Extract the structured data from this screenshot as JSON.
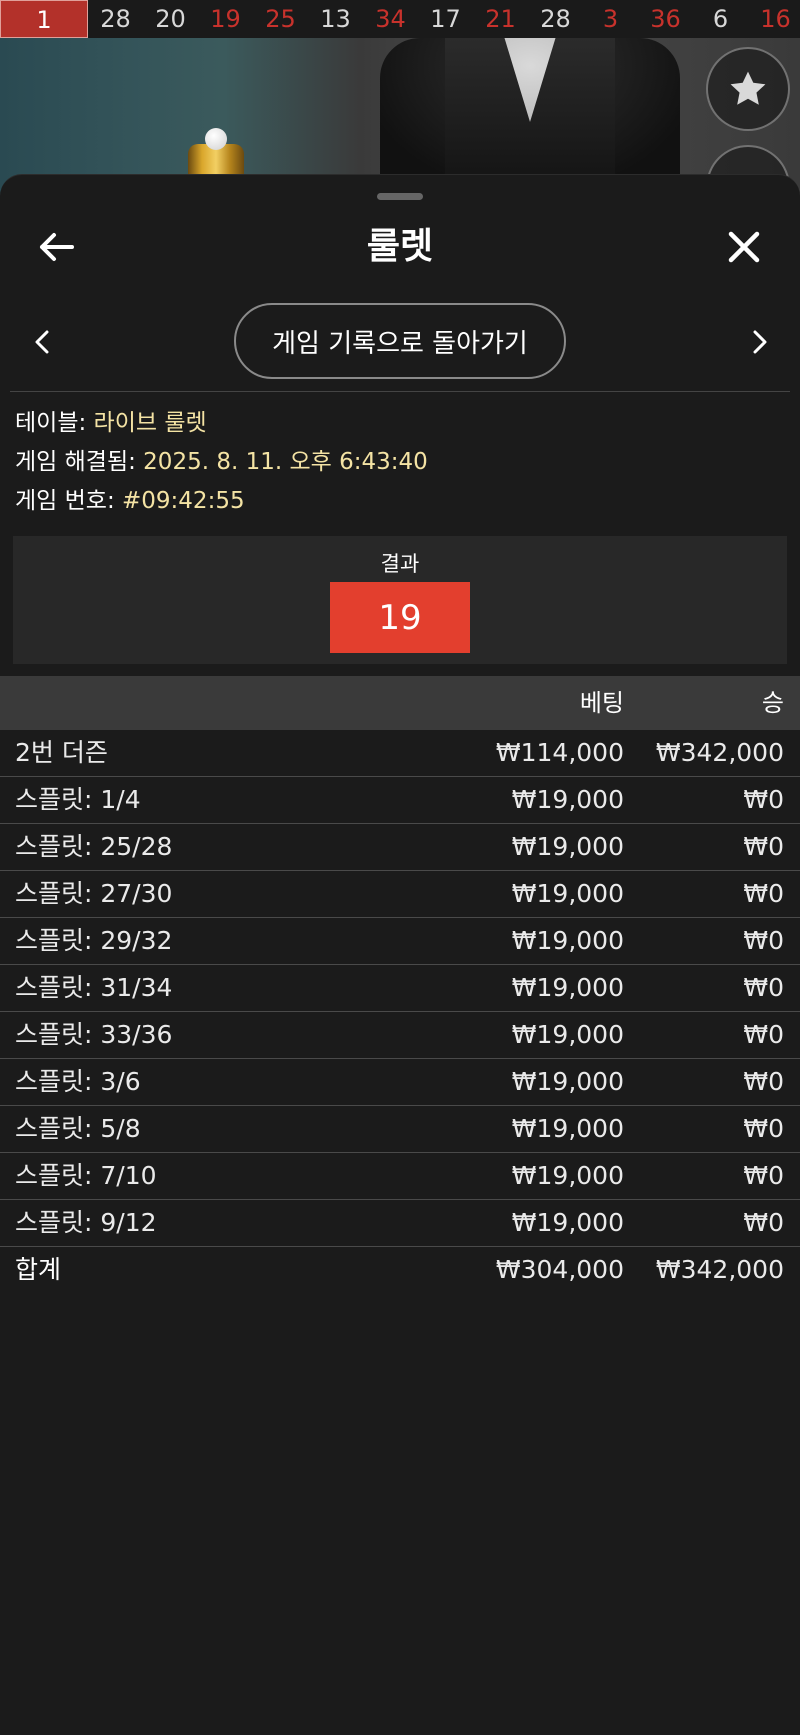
{
  "history": {
    "numbers": [
      {
        "value": "1",
        "color": "red",
        "highlight": true
      },
      {
        "value": "28",
        "color": "black"
      },
      {
        "value": "20",
        "color": "black"
      },
      {
        "value": "19",
        "color": "red"
      },
      {
        "value": "25",
        "color": "red"
      },
      {
        "value": "13",
        "color": "black"
      },
      {
        "value": "34",
        "color": "red"
      },
      {
        "value": "17",
        "color": "black"
      },
      {
        "value": "21",
        "color": "red"
      },
      {
        "value": "28",
        "color": "black"
      },
      {
        "value": "3",
        "color": "red"
      },
      {
        "value": "36",
        "color": "red"
      },
      {
        "value": "6",
        "color": "black"
      },
      {
        "value": "16",
        "color": "red"
      }
    ]
  },
  "header": {
    "title": "룰렛",
    "back_icon": "arrow-left-icon",
    "close_icon": "close-icon"
  },
  "nav": {
    "back_to_history_label": "게임 기록으로 돌아가기",
    "prev_icon": "chevron-left-icon",
    "next_icon": "chevron-right-icon"
  },
  "meta": {
    "table_label": "테이블: ",
    "table_value": "라이브 룰렛",
    "resolved_label": "게임 해결됨: ",
    "resolved_value": "2025. 8. 11. 오후 6:43:40",
    "game_no_label": "게임 번호: ",
    "game_no_value": "#09:42:55"
  },
  "result": {
    "label": "결과",
    "number": "19",
    "color": "#e33f2e"
  },
  "bets_table": {
    "col_bet": "베팅",
    "col_win": "승",
    "rows": [
      {
        "name": "2번 더즌",
        "bet": "₩114,000",
        "win": "₩342,000"
      },
      {
        "name": "스플릿: 1/4",
        "bet": "₩19,000",
        "win": "₩0"
      },
      {
        "name": "스플릿: 25/28",
        "bet": "₩19,000",
        "win": "₩0"
      },
      {
        "name": "스플릿: 27/30",
        "bet": "₩19,000",
        "win": "₩0"
      },
      {
        "name": "스플릿: 29/32",
        "bet": "₩19,000",
        "win": "₩0"
      },
      {
        "name": "스플릿: 31/34",
        "bet": "₩19,000",
        "win": "₩0"
      },
      {
        "name": "스플릿: 33/36",
        "bet": "₩19,000",
        "win": "₩0"
      },
      {
        "name": "스플릿: 3/6",
        "bet": "₩19,000",
        "win": "₩0"
      },
      {
        "name": "스플릿: 5/8",
        "bet": "₩19,000",
        "win": "₩0"
      },
      {
        "name": "스플릿: 7/10",
        "bet": "₩19,000",
        "win": "₩0"
      },
      {
        "name": "스플릿: 9/12",
        "bet": "₩19,000",
        "win": "₩0"
      }
    ],
    "total": {
      "name": "합계",
      "bet": "₩304,000",
      "win": "₩342,000"
    }
  },
  "colors": {
    "red_number": "#c8322c",
    "highlight_bg": "#b3312a",
    "meta_value": "#f4e3a4",
    "background": "#1b1b1b"
  },
  "side_buttons": [
    "star-icon",
    "more-icon"
  ]
}
